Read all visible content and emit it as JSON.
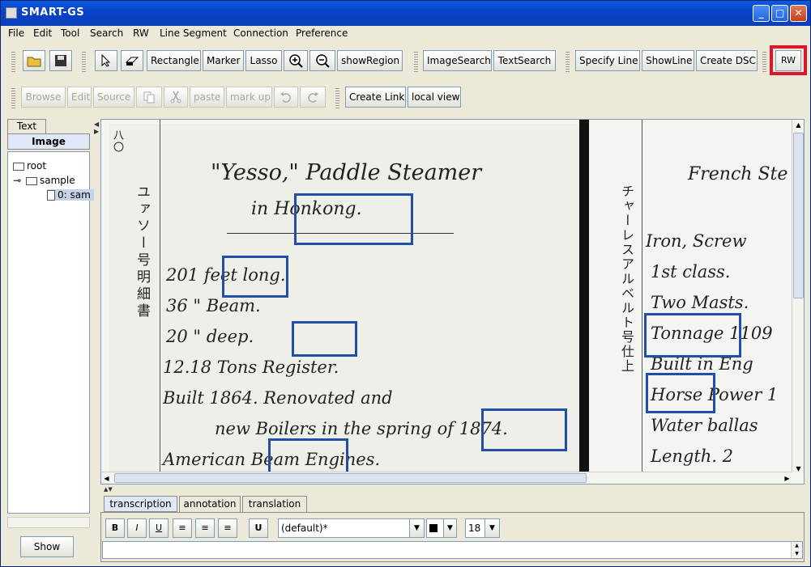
{
  "window": {
    "title": "SMART-GS"
  },
  "menu": [
    "File",
    "Edit",
    "Tool",
    "Search",
    "RW",
    "Line Segment",
    "Connection",
    "Preference"
  ],
  "toolbar1": {
    "rectangle": "Rectangle",
    "marker": "Marker",
    "lasso": "Lasso",
    "show_region": "showRegion",
    "image_search": "ImageSearch",
    "text_search": "TextSearch",
    "specify_line": "Specify Line",
    "show_line": "ShowLine",
    "create_dsc": "Create DSC",
    "rw": "RW"
  },
  "toolbar2": {
    "browse": "Browse",
    "edit": "Edit",
    "source": "Source",
    "paste": "paste",
    "markup": "mark up",
    "create_link": "Create Link",
    "local_view": "local view"
  },
  "left_tabs": {
    "text": "Text",
    "image": "Image"
  },
  "tree": {
    "root": "root",
    "sample": "sample",
    "file": "0: sam"
  },
  "show_button": "Show",
  "manuscript": {
    "page_number": "八〇",
    "lines": [
      "\"Yesso,\" Paddle Steamer",
      "in Honkong.",
      "201   feet long.",
      "36   \"  Beam.",
      "20   \"  deep.",
      "12.18  Tons Register.",
      "Built 1864.    Renovated and",
      "new Boilers in the spring of 1874.",
      "American Beam Engines."
    ],
    "jp_left": "ユァソー号明細書",
    "jp_right": "チャーレスアルベルト号仕上",
    "right_lines": [
      "French Ste",
      "Iron, Screw",
      "1st class.",
      "Two Masts.",
      "Tonnage 1109",
      "Built in Eng",
      "Horse Power 1",
      "Water ballas",
      "Length. 2"
    ]
  },
  "bottom_tabs": {
    "transcription": "transcription",
    "annotation": "annotation",
    "translation": "translation"
  },
  "format": {
    "bold": "B",
    "italic": "I",
    "underline": "U",
    "font": "(default)*",
    "size": "18"
  },
  "colors": {
    "highlight_box": "#1f4fa8",
    "rw_highlight": "#d9182d"
  }
}
